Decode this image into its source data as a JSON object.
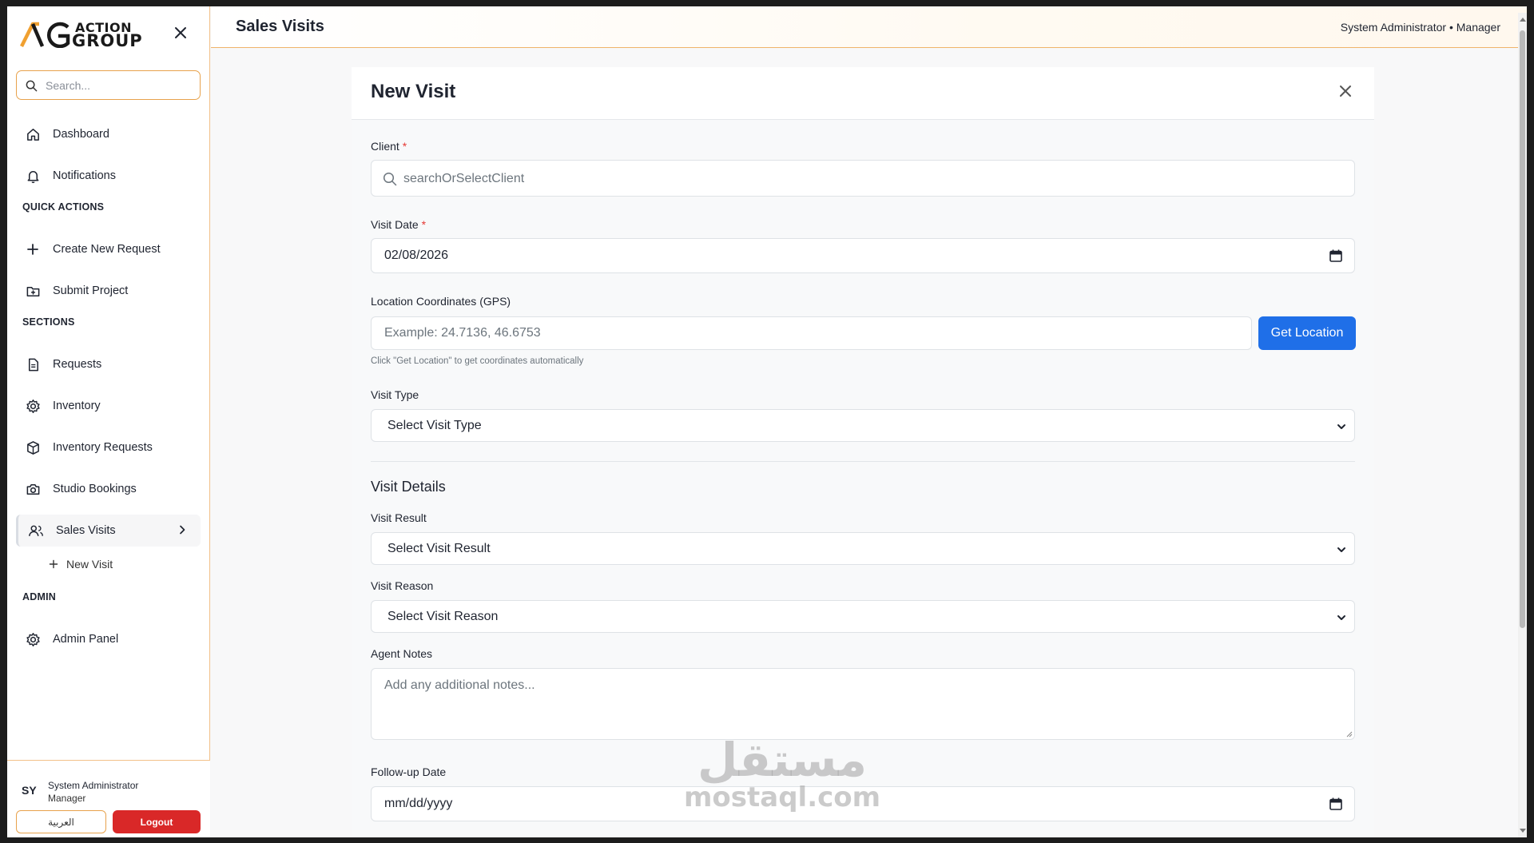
{
  "brand": {
    "line1": "ACTION",
    "line2": "GROUP",
    "accent": "#f0a030"
  },
  "sidebar": {
    "search_placeholder": "Search...",
    "items": [
      {
        "label": "Dashboard",
        "icon": "home-icon"
      },
      {
        "label": "Notifications",
        "icon": "bell-icon"
      }
    ],
    "quick_actions_title": "QUICK ACTIONS",
    "quick_actions": [
      {
        "label": "Create New Request",
        "icon": "plus-icon"
      },
      {
        "label": "Submit Project",
        "icon": "folder-plus-icon"
      }
    ],
    "sections_title": "SECTIONS",
    "sections": [
      {
        "label": "Requests",
        "icon": "document-icon"
      },
      {
        "label": "Inventory",
        "icon": "gear-icon"
      },
      {
        "label": "Inventory Requests",
        "icon": "box-icon"
      },
      {
        "label": "Studio Bookings",
        "icon": "camera-icon"
      },
      {
        "label": "Sales Visits",
        "icon": "users-icon",
        "active": true
      }
    ],
    "sub_item": "New Visit",
    "admin_title": "ADMIN",
    "admin": [
      {
        "label": "Admin Panel",
        "icon": "gear-icon"
      }
    ],
    "footer": {
      "avatar": "SY",
      "name": "System Administrator",
      "role": "Manager",
      "lang_button": "العربية",
      "logout_button": "Logout",
      "logout_color": "#d92828"
    }
  },
  "header": {
    "title": "Sales Visits",
    "user": "System Administrator • Manager"
  },
  "form": {
    "title": "New Visit",
    "client_label": "Client",
    "client_placeholder": "searchOrSelectClient",
    "visit_date_label": "Visit Date",
    "visit_date_value": "02/08/2026",
    "gps_label": "Location Coordinates (GPS)",
    "gps_placeholder": "Example: 24.7136, 46.6753",
    "gps_button": "Get Location",
    "gps_hint": "Click \"Get Location\" to get coordinates automatically",
    "visit_type_label": "Visit Type",
    "visit_type_value": "Select Visit Type",
    "details_heading": "Visit Details",
    "visit_result_label": "Visit Result",
    "visit_result_value": "Select Visit Result",
    "visit_reason_label": "Visit Reason",
    "visit_reason_value": "Select Visit Reason",
    "notes_label": "Agent Notes",
    "notes_placeholder": "Add any additional notes...",
    "followup_label": "Follow-up Date",
    "followup_placeholder": "mm/dd/yyyy",
    "required_mark": "*",
    "button_color": "#1f6fe8"
  },
  "watermark": {
    "arabic": "مستقل",
    "latin": "mostaql.com"
  }
}
